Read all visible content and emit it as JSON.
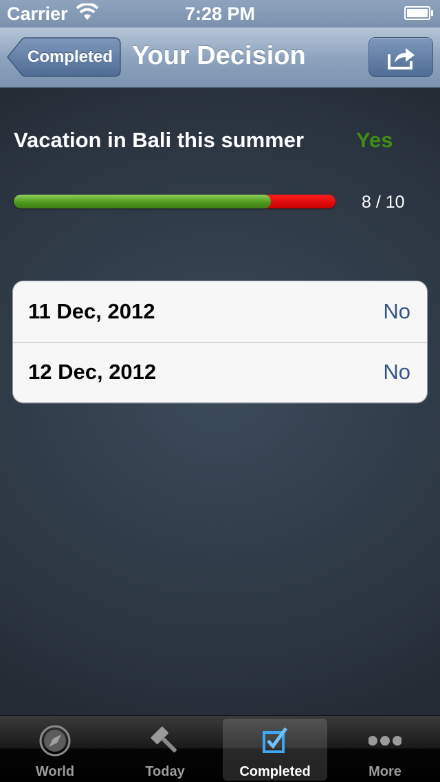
{
  "status_bar": {
    "carrier": "Carrier",
    "time": "7:28 PM"
  },
  "nav_bar": {
    "back_label": "Completed",
    "title": "Your Decision",
    "share_icon": "share-icon"
  },
  "decision": {
    "title": "Vacation in Bali this summer",
    "answer": "Yes",
    "answer_color": "#3f8d16",
    "score_text": "8 / 10",
    "score_fraction": 0.8
  },
  "history": [
    {
      "date": "11 Dec, 2012",
      "answer": "No"
    },
    {
      "date": "12 Dec, 2012",
      "answer": "No"
    }
  ],
  "tab_bar": {
    "selected": "Completed",
    "tabs": [
      {
        "label": "World",
        "icon": "compass-icon"
      },
      {
        "label": "Today",
        "icon": "gavel-icon"
      },
      {
        "label": "Completed",
        "icon": "checkbox-icon"
      },
      {
        "label": "More",
        "icon": "more-dots-icon"
      }
    ]
  }
}
